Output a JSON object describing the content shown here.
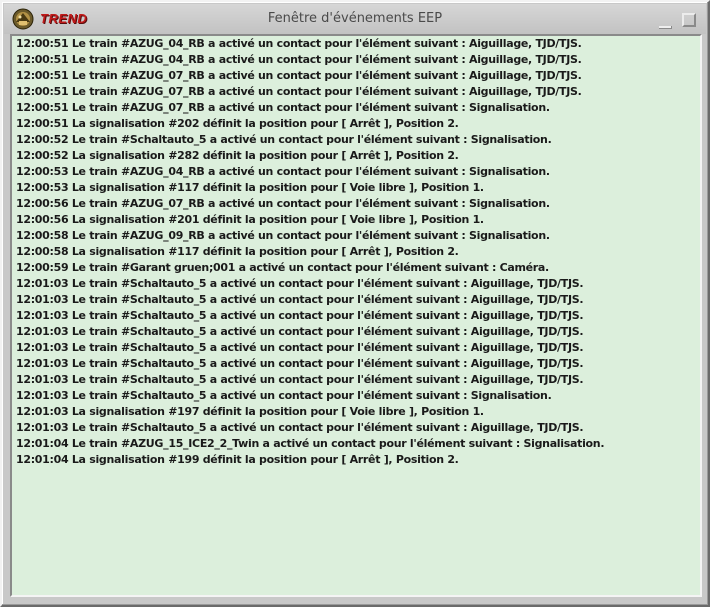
{
  "window": {
    "title": "Fenêtre d'événements EEP",
    "logo_text": "TREND",
    "icons": {
      "logo": "trend-logo-icon",
      "minimize": "minimize-icon",
      "maximize": "maximize-icon"
    }
  },
  "log": {
    "lines": [
      "12:00:51 Le train #AZUG_04_RB a activé un contact pour l'élément suivant : Aiguillage, TJD/TJS.",
      "12:00:51 Le train #AZUG_04_RB a activé un contact pour l'élément suivant : Aiguillage, TJD/TJS.",
      "12:00:51 Le train #AZUG_07_RB a activé un contact pour l'élément suivant : Aiguillage, TJD/TJS.",
      "12:00:51 Le train #AZUG_07_RB a activé un contact pour l'élément suivant : Aiguillage, TJD/TJS.",
      "12:00:51 Le train #AZUG_07_RB a activé un contact pour l'élément suivant : Signalisation.",
      "12:00:51 La signalisation #202 définit la position pour [ Arrêt ], Position 2.",
      "12:00:52 Le train #Schaltauto_5 a activé un contact pour l'élément suivant : Signalisation.",
      "12:00:52 La signalisation #282 définit la position pour [ Arrêt ], Position 2.",
      "12:00:53 Le train #AZUG_04_RB a activé un contact pour l'élément suivant : Signalisation.",
      "12:00:53 La signalisation #117 définit la position pour [ Voie libre ], Position 1.",
      "12:00:56 Le train #AZUG_07_RB a activé un contact pour l'élément suivant : Signalisation.",
      "12:00:56 La signalisation #201 définit la position pour [ Voie libre ], Position 1.",
      "12:00:58 Le train #AZUG_09_RB a activé un contact pour l'élément suivant : Signalisation.",
      "12:00:58 La signalisation #117 définit la position pour [ Arrêt ], Position 2.",
      "12:00:59 Le train #Garant gruen;001 a activé un contact pour l'élément suivant : Caméra.",
      "12:01:03 Le train #Schaltauto_5 a activé un contact pour l'élément suivant : Aiguillage, TJD/TJS.",
      "12:01:03 Le train #Schaltauto_5 a activé un contact pour l'élément suivant : Aiguillage, TJD/TJS.",
      "12:01:03 Le train #Schaltauto_5 a activé un contact pour l'élément suivant : Aiguillage, TJD/TJS.",
      "12:01:03 Le train #Schaltauto_5 a activé un contact pour l'élément suivant : Aiguillage, TJD/TJS.",
      "12:01:03 Le train #Schaltauto_5 a activé un contact pour l'élément suivant : Aiguillage, TJD/TJS.",
      "12:01:03 Le train #Schaltauto_5 a activé un contact pour l'élément suivant : Aiguillage, TJD/TJS.",
      "12:01:03 Le train #Schaltauto_5 a activé un contact pour l'élément suivant : Aiguillage, TJD/TJS.",
      "12:01:03 Le train #Schaltauto_5 a activé un contact pour l'élément suivant : Signalisation.",
      "12:01:03 La signalisation #197 définit la position pour [ Voie libre ], Position 1.",
      "12:01:03 Le train #Schaltauto_5 a activé un contact pour l'élément suivant : Aiguillage, TJD/TJS.",
      "12:01:04 Le train #AZUG_15_ICE2_2_Twin a activé un contact pour l'élément suivant : Signalisation.",
      "12:01:04 La signalisation #199 définit la position pour [ Arrêt ], Position 2."
    ]
  }
}
